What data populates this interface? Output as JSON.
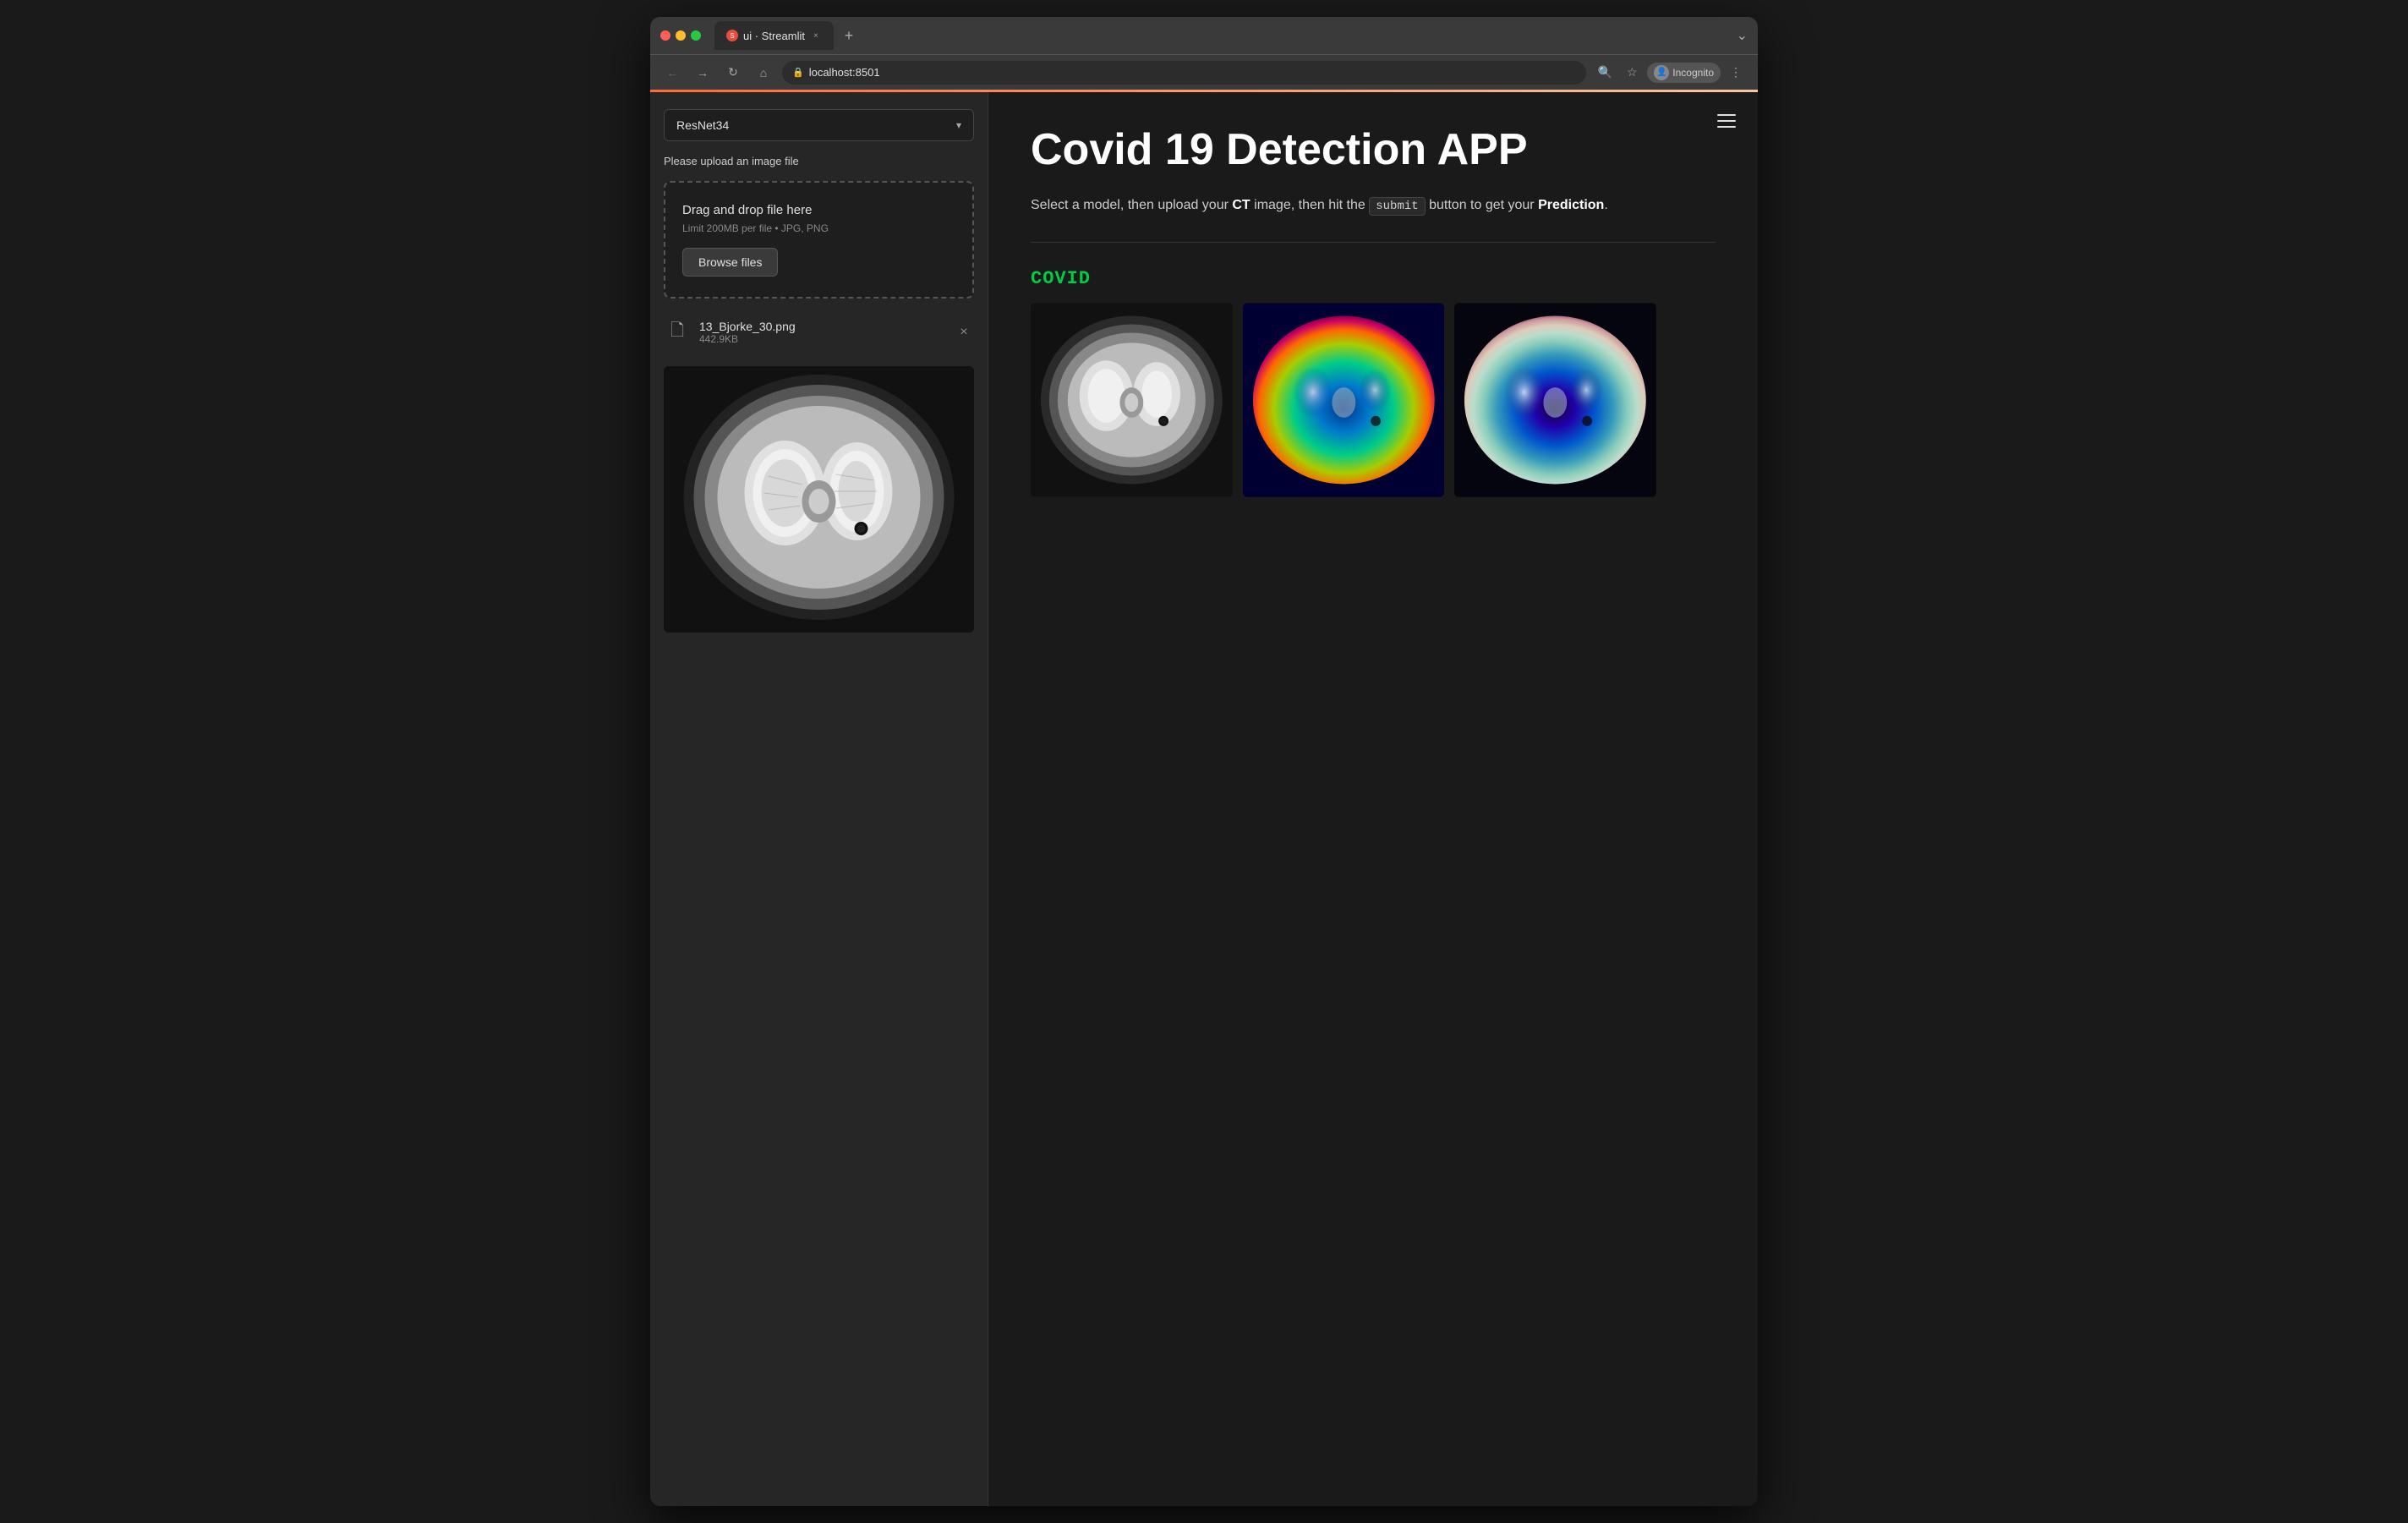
{
  "browser": {
    "tab_title": "ui · Streamlit",
    "tab_favicon": "S",
    "url": "localhost:8501",
    "new_tab_label": "+",
    "chevron_label": "⌄"
  },
  "sidebar": {
    "model_select": {
      "value": "ResNet34",
      "arrow": "▾"
    },
    "upload_label": "Please upload an image file",
    "dropzone": {
      "title": "Drag and drop file here",
      "subtitle": "Limit 200MB per file • JPG, PNG",
      "browse_label": "Browse files"
    },
    "file": {
      "name": "13_Bjorke_30.png",
      "size": "442.9KB"
    }
  },
  "main": {
    "title": "Covid 19 Detection APP",
    "subtitle_part1": "Select a model, then upload your ",
    "subtitle_ct": "CT",
    "subtitle_part2": " image, then hit the ",
    "subtitle_code": "submit",
    "subtitle_part3": " button to get your ",
    "subtitle_bold": "Prediction",
    "subtitle_end": ".",
    "prediction": {
      "label": "COVID"
    },
    "hamburger": "☰"
  },
  "icons": {
    "back": "←",
    "forward": "→",
    "reload": "↻",
    "home": "⌂",
    "lock": "🔒",
    "bookmark": "☆",
    "zoom": "🔍",
    "menu": "⋮",
    "file_doc": "🗋",
    "close": "×"
  }
}
